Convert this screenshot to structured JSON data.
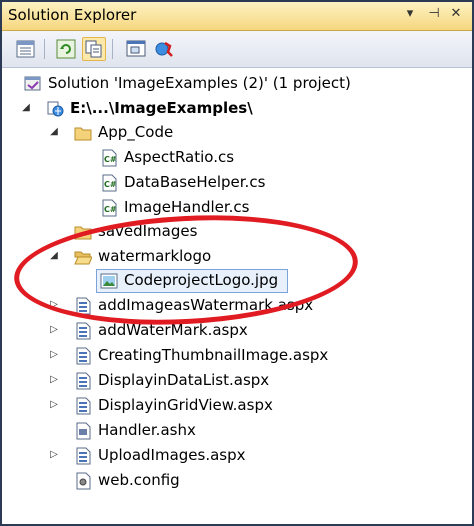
{
  "window": {
    "title": "Solution Explorer"
  },
  "title_controls": {
    "dropdown": "▾",
    "pin": "⊣",
    "close": "✕"
  },
  "toolbar": {
    "buttons": [
      "properties-icon",
      "refresh-icon",
      "show-all-files-icon",
      "view-code-icon",
      "copy-website-icon"
    ]
  },
  "tree": [
    {
      "label": "Solution 'ImageExamples (2)' (1 project)",
      "icon": "solution-icon",
      "twisty": ""
    },
    {
      "label": "E:\\...\\ImageExamples\\",
      "icon": "website-project-icon",
      "twisty": "◢",
      "bold": true
    },
    {
      "label": "App_Code",
      "icon": "folder-icon",
      "twisty": "◢"
    },
    {
      "label": "AspectRatio.cs",
      "icon": "csharp-file-icon",
      "twisty": ""
    },
    {
      "label": "DataBaseHelper.cs",
      "icon": "csharp-file-icon",
      "twisty": ""
    },
    {
      "label": "ImageHandler.cs",
      "icon": "csharp-file-icon",
      "twisty": ""
    },
    {
      "label": "savedImages",
      "icon": "folder-icon",
      "twisty": ""
    },
    {
      "label": "watermarklogo",
      "icon": "folder-open-icon",
      "twisty": "◢"
    },
    {
      "label": "CodeprojectLogo.jpg",
      "icon": "image-file-icon",
      "twisty": "",
      "selected": true
    },
    {
      "label": "addImageasWatermark.aspx",
      "icon": "aspx-file-icon",
      "twisty": "▷"
    },
    {
      "label": "addWaterMark.aspx",
      "icon": "aspx-file-icon",
      "twisty": "▷"
    },
    {
      "label": "CreatingThumbnailImage.aspx",
      "icon": "aspx-file-icon",
      "twisty": "▷"
    },
    {
      "label": "DisplayinDataList.aspx",
      "icon": "aspx-file-icon",
      "twisty": "▷"
    },
    {
      "label": "DisplayinGridView.aspx",
      "icon": "aspx-file-icon",
      "twisty": "▷"
    },
    {
      "label": "Handler.ashx",
      "icon": "handler-file-icon",
      "twisty": ""
    },
    {
      "label": "UploadImages.aspx",
      "icon": "aspx-file-icon",
      "twisty": "▷"
    },
    {
      "label": "web.config",
      "icon": "config-file-icon",
      "twisty": ""
    }
  ]
}
